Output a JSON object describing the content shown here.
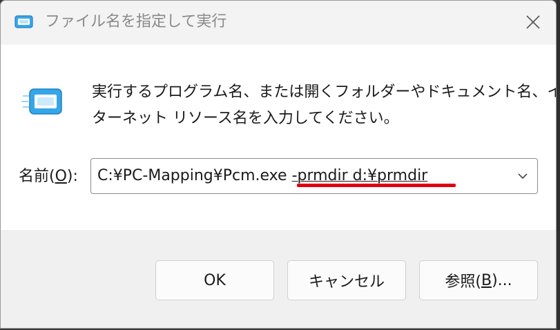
{
  "window": {
    "title": "ファイル名を指定して実行",
    "close_icon": "close-icon"
  },
  "description": {
    "line1": "実行するプログラム名、または開くフォルダーやドキュメント名、イン",
    "line2": "ターネット リソース名を入力してください。"
  },
  "name_field": {
    "label_prefix": "名前(",
    "label_accel": "O",
    "label_suffix": "):",
    "value_head": "C:¥PC-Mapping¥Pcm.exe ",
    "value_tail": "-prmdir d:¥prmdir"
  },
  "buttons": {
    "ok": "OK",
    "cancel": "キャンセル",
    "browse_prefix": "参照(",
    "browse_accel": "B",
    "browse_suffix": ")..."
  },
  "colors": {
    "accent": "#0a84d6",
    "highlight_mark": "#e00010"
  }
}
